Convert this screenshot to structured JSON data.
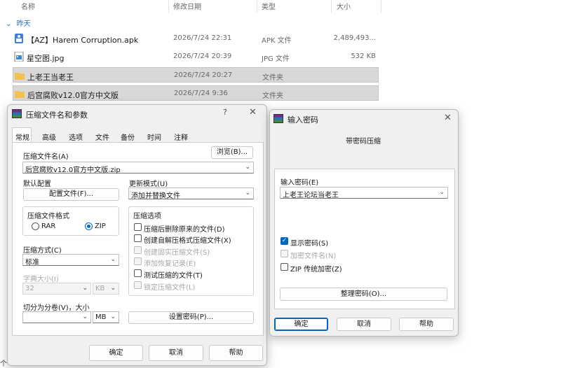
{
  "explorer": {
    "columns": {
      "name": "名称",
      "modified": "修改日期",
      "type": "类型",
      "size": "大小"
    },
    "group_label": "昨天",
    "files": [
      {
        "name": "【AZ】Harem Corruption.apk",
        "date": "2026/7/24 22:31",
        "type": "APK 文件",
        "size": "2,489,493...",
        "icon": "apk-file-icon"
      },
      {
        "name": "星空图.jpg",
        "date": "2026/7/24 20:39",
        "type": "JPG 文件",
        "size": "532 KB",
        "icon": "image-file-icon"
      },
      {
        "name": "上老王当老王",
        "date": "2026/7/24 20:27",
        "type": "文件夹",
        "size": "",
        "icon": "folder-icon"
      },
      {
        "name": "后宫腐败v12.0官方中文版",
        "date": "2026/7/24 9:36",
        "type": "文件夹",
        "size": "",
        "icon": "folder-icon"
      }
    ],
    "partial_char": "个"
  },
  "archive_dialog": {
    "title": "压缩文件名和参数",
    "help_glyph": "?",
    "close_glyph": "✕",
    "tabs": [
      "常规",
      "高级",
      "选项",
      "文件",
      "备份",
      "时间",
      "注释"
    ],
    "archive_name_label": "压缩文件名(A)",
    "browse_button": "浏览(B)...",
    "archive_name_value": "后宫腐败v12.0官方中文版.zip",
    "default_profile_label": "默认配置",
    "profiles_button": "配置文件(F)...",
    "update_mode_label": "更新模式(U)",
    "update_mode_value": "添加并替换文件",
    "format_label": "压缩文件格式",
    "format_rar": "RAR",
    "format_zip": "ZIP",
    "selected_format": "ZIP",
    "options_label": "压缩选项",
    "options": [
      {
        "label": "压缩后删除原来的文件(D)",
        "checked": false,
        "disabled": false
      },
      {
        "label": "创建自解压格式压缩文件(X)",
        "checked": false,
        "disabled": false
      },
      {
        "label": "创建固实压缩文件(S)",
        "checked": false,
        "disabled": true
      },
      {
        "label": "添加恢复记录(E)",
        "checked": false,
        "disabled": true
      },
      {
        "label": "测试压缩的文件(T)",
        "checked": false,
        "disabled": false
      },
      {
        "label": "锁定压缩文件(L)",
        "checked": false,
        "disabled": true
      }
    ],
    "method_label": "压缩方式(C)",
    "method_value": "标准",
    "dict_label": "字典大小(I)",
    "dict_value": "32",
    "dict_unit": "KB",
    "split_label": "切分为分卷(V)，大小",
    "split_value": "",
    "split_unit": "MB",
    "set_password_button": "设置密码(P)...",
    "ok": "确定",
    "cancel": "取消",
    "help": "帮助"
  },
  "password_dialog": {
    "title": "输入密码",
    "close_glyph": "✕",
    "header": "带密码压缩",
    "enter_label": "输入密码(E)",
    "password_value": "上老王论坛当老王",
    "show_password": "显示密码(S)",
    "encrypt_names": "加密文件名(N)",
    "zip_legacy": "ZIP 传统加密(Z)",
    "organize_button": "整理密码(O)...",
    "ok": "确定",
    "cancel": "取消",
    "help": "帮助"
  },
  "colors": {
    "accent": "#0067c0",
    "selected_row": "#d8d8d8",
    "folder": "#f2c14e"
  }
}
